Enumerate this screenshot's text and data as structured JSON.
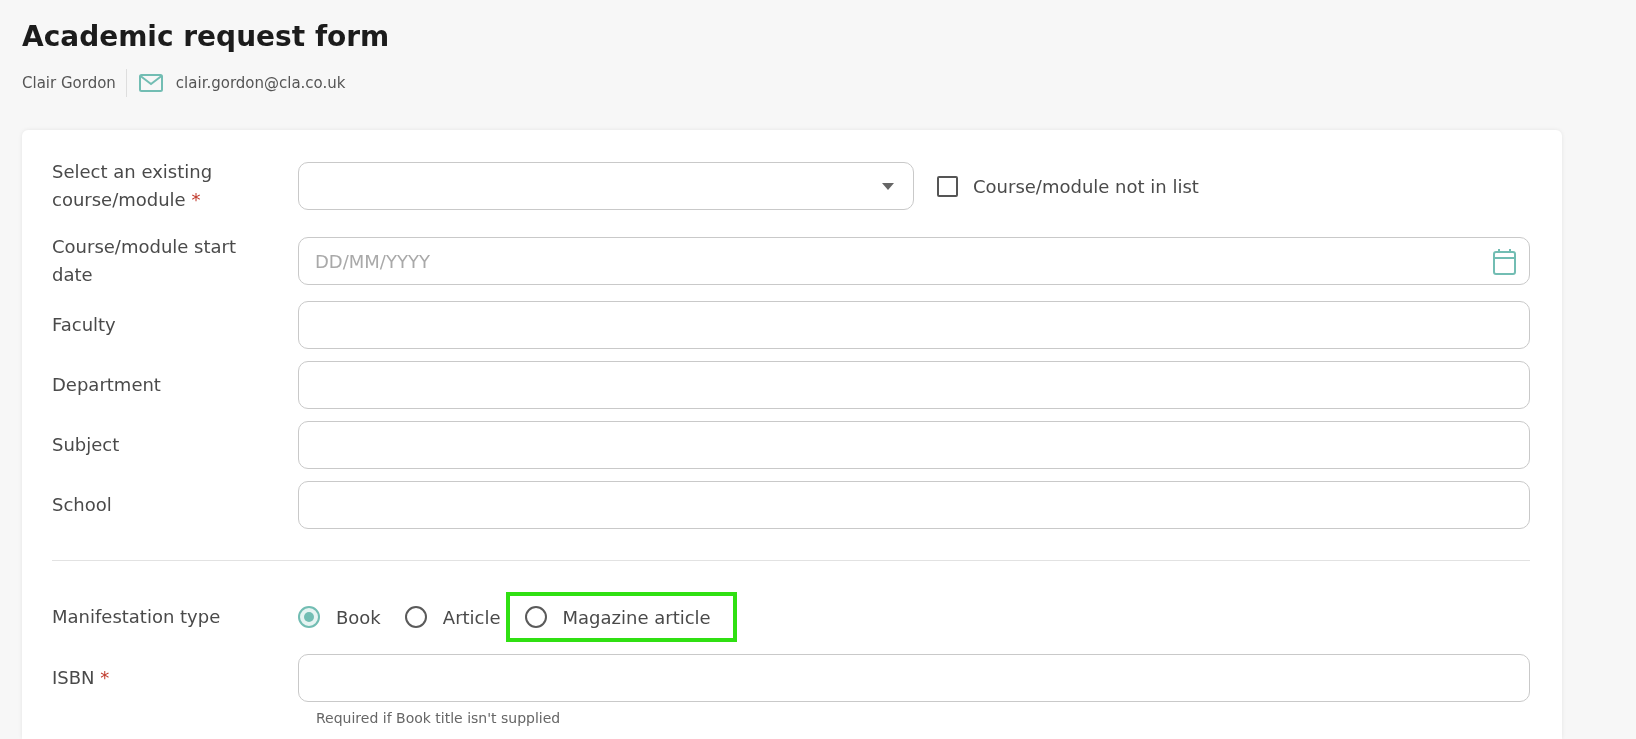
{
  "header": {
    "title": "Academic request form",
    "user_name": "Clair Gordon",
    "email": "clair.gordon@cla.co.uk"
  },
  "course_fields": [
    {
      "kind": "select",
      "label": "Select an existing course/module",
      "required_mark": "*",
      "checkbox": {
        "label": "Course/module not in list",
        "checked": false
      }
    },
    {
      "kind": "date",
      "label": "Course/module start date",
      "placeholder": "DD/MM/YYYY"
    },
    {
      "kind": "text",
      "label": "Faculty"
    },
    {
      "kind": "text",
      "label": "Department"
    },
    {
      "kind": "text",
      "label": "Subject"
    },
    {
      "kind": "text",
      "label": "School"
    }
  ],
  "manifestation": {
    "label": "Manifestation type",
    "options": [
      {
        "label": "Book",
        "selected": true,
        "highlighted": false
      },
      {
        "label": "Article",
        "selected": false,
        "highlighted": false
      },
      {
        "label": "Magazine article",
        "selected": false,
        "highlighted": true
      }
    ]
  },
  "isbn": {
    "label": "ISBN",
    "required_mark": "*",
    "hint": "Required if Book title isn't supplied"
  }
}
